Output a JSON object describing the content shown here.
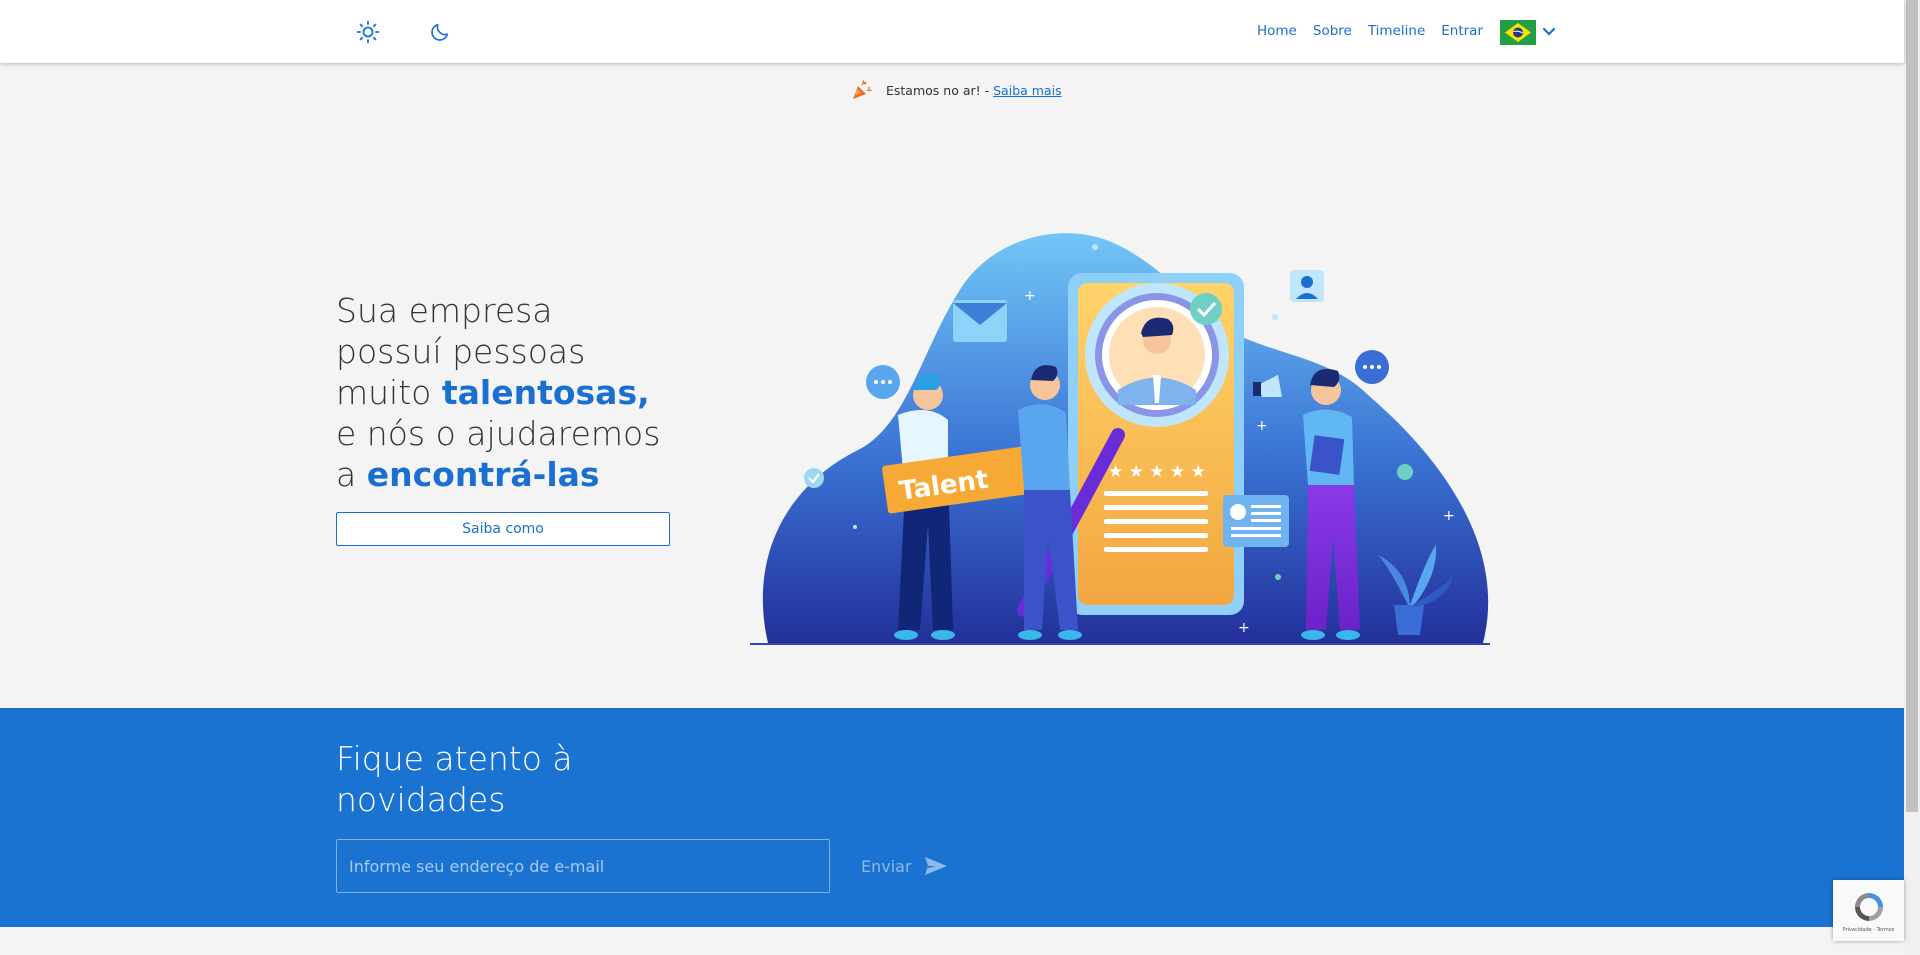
{
  "header": {
    "nav": [
      {
        "label": "Home"
      },
      {
        "label": "Sobre"
      },
      {
        "label": "Timeline"
      },
      {
        "label": "Entrar"
      }
    ],
    "language": "pt-BR flag"
  },
  "announcement": {
    "text": "Estamos no ar! -",
    "link": "Saiba mais"
  },
  "hero": {
    "line1": "Sua empresa",
    "line2": "possuí pessoas",
    "line3_pre": "muito ",
    "line3_bold": "talentosas,",
    "line4": "e nós o ajudaremos",
    "line5_pre": "a ",
    "line5_bold": "encontrá-las",
    "cta": "Saiba como",
    "illustration_text": "Talent"
  },
  "newsletter": {
    "title_line1": "Fique atento à",
    "title_line2": "novidades",
    "placeholder": "Informe seu endereço de e-mail",
    "send_label": "Enviar"
  },
  "recaptcha": {
    "text": "Privacidade - Termos"
  },
  "colors": {
    "accent": "#1a6fd1",
    "newsletter_bg": "#1a73d1",
    "page_bg": "#f4f4f4"
  }
}
